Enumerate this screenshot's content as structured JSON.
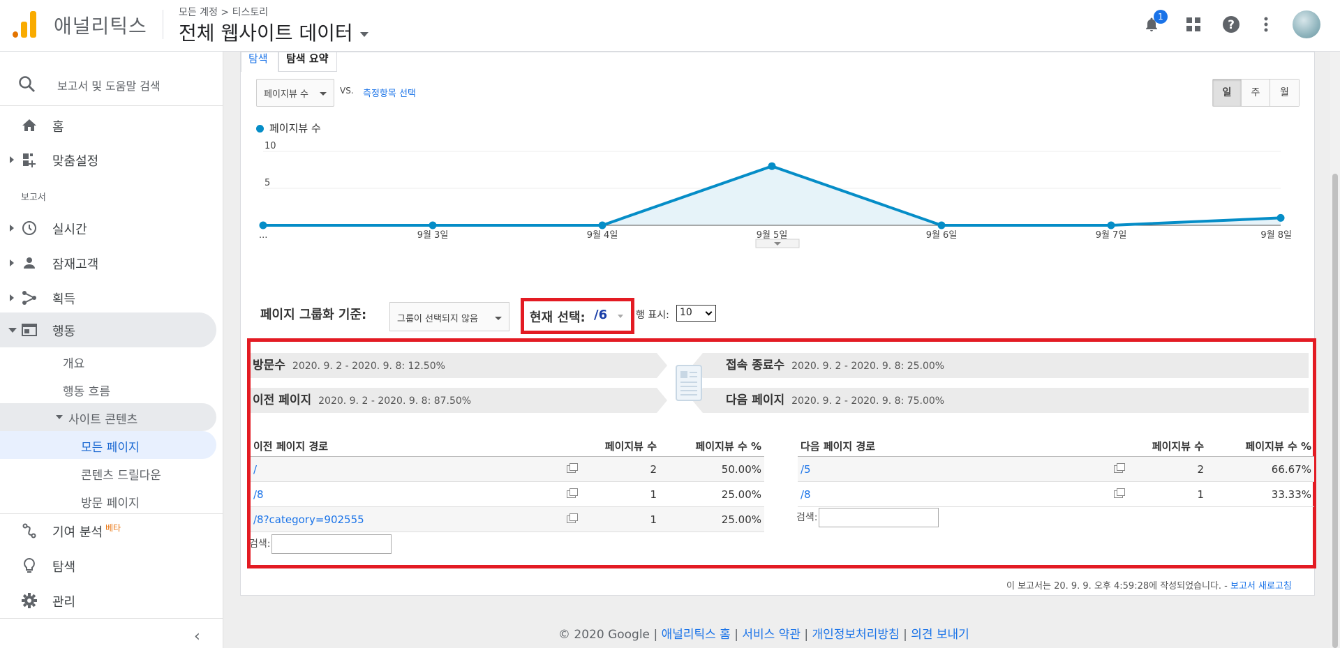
{
  "header": {
    "app_name": "애널리틱스",
    "breadcrumb": "모든 계정 > 티스토리",
    "property": "전체 웹사이트 데이터",
    "notification_count": "1"
  },
  "sidebar": {
    "search_label": "보고서 및 도움말 검색",
    "home": "홈",
    "customization": "맞춤설정",
    "reports_section": "보고서",
    "realtime": "실시간",
    "audience": "잠재고객",
    "acquisition": "획득",
    "behavior": "행동",
    "behavior_sub": {
      "overview": "개요",
      "flow": "행동 흐름",
      "site_content": "사이트 콘텐츠",
      "all_pages": "모든 페이지",
      "drilldown": "콘텐츠 드릴다운",
      "landing": "방문 페이지"
    },
    "attribution": "기여 분석",
    "beta": "베타",
    "discover": "탐색",
    "admin": "관리"
  },
  "tabs": [
    "탐색",
    "탐색 요약"
  ],
  "metric_select": "페이지뷰 수",
  "vs_label": "VS.",
  "compare_link": "측정항목 선택",
  "period": {
    "day": "일",
    "week": "주",
    "month": "월"
  },
  "legend": "페이지뷰 수",
  "chart_data": {
    "type": "area",
    "series": [
      {
        "name": "페이지뷰 수",
        "values": [
          0,
          0,
          0,
          8,
          0,
          0,
          1
        ]
      }
    ],
    "categories": [
      "...",
      "9월 3일",
      "9월 4일",
      "9월 5일",
      "9월 6일",
      "9월 7일",
      "9월 8일"
    ],
    "yticks": [
      "10",
      "5"
    ],
    "ylim": [
      0,
      10
    ],
    "color": "#058dc7"
  },
  "grouping": {
    "label": "페이지 그룹화 기준:",
    "select": "그룹이 선택되지 않음",
    "current_label": "현재 선택:",
    "current_value": "/6",
    "rows_label": "행 표시:",
    "rows_value": "10"
  },
  "flow": {
    "entrances": {
      "label": "방문수",
      "value": "2020. 9. 2 - 2020. 9. 8: 12.50%"
    },
    "prev_pages": {
      "label": "이전 페이지",
      "value": "2020. 9. 2 - 2020. 9. 8: 87.50%"
    },
    "exits": {
      "label": "접속 종료수",
      "value": "2020. 9. 2 - 2020. 9. 8: 25.00%"
    },
    "next_pages": {
      "label": "다음 페이지",
      "value": "2020. 9. 2 - 2020. 9. 8: 75.00%"
    }
  },
  "prev_table": {
    "headers": [
      "이전 페이지 경로",
      "페이지뷰 수",
      "페이지뷰 수 %"
    ],
    "rows": [
      {
        "path": "/",
        "views": "2",
        "pct": "50.00%"
      },
      {
        "path": "/8",
        "views": "1",
        "pct": "25.00%"
      },
      {
        "path": "/8?category=902555",
        "views": "1",
        "pct": "25.00%"
      }
    ],
    "search_label": "검색:"
  },
  "next_table": {
    "headers": [
      "다음 페이지 경로",
      "페이지뷰 수",
      "페이지뷰 수 %"
    ],
    "rows": [
      {
        "path": "/5",
        "views": "2",
        "pct": "66.67%"
      },
      {
        "path": "/8",
        "views": "1",
        "pct": "33.33%"
      }
    ],
    "search_label": "검색:"
  },
  "report_note": "이 보고서는 20. 9. 9. 오후 4:59:28에 작성되었습니다. - ",
  "refresh_link": "보고서 새로고침",
  "footer": {
    "copyright": "© 2020 Google",
    "links": [
      "애널리틱스 홈",
      "서비스 약관",
      "개인정보처리방침",
      "의견 보내기"
    ],
    "sep": "|"
  }
}
